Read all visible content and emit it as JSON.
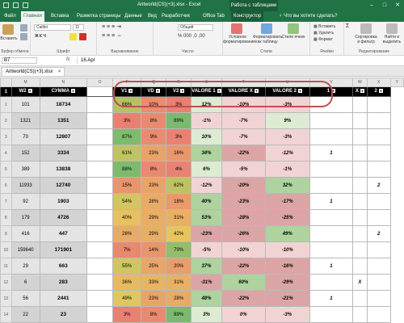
{
  "window": {
    "title": "Aritworld(CS)(+3).xlsx - Excel",
    "context_group": "Работа с таблицами"
  },
  "tabs": [
    "Файл",
    "Главная",
    "Вставка",
    "Разметка страницы",
    "Данные",
    "Вид",
    "Разработчик",
    "Office Tab",
    "Конструктор"
  ],
  "active_tab": "Главная",
  "tell_me": "Что вы хотите сделать?",
  "ribbon": {
    "paste_label": "Вставить",
    "clipboard_label": "Буфер обмена",
    "font_name": "Calibri",
    "font_size": "11",
    "font_label": "Шрифт",
    "align_label": "Выравнивание",
    "number_format": "Общий",
    "number_label": "Число",
    "cond_format": "Условное форматирование",
    "format_table": "Форматировать как таблицу",
    "cell_styles": "Стили ячеек",
    "styles_label": "Стили",
    "insert": "Вставить",
    "delete": "Удалить",
    "format": "Формат",
    "cells_label": "Ячейки",
    "sort_filter": "Сортировка и фильтр",
    "find_select": "Найти и выделить",
    "editing_label": "Редактирование"
  },
  "formula_bar": {
    "name_box": "B7",
    "fx": "fx",
    "value": "16.Apr"
  },
  "workbook_tab": "Aritworld(CS)(+3).xlsx",
  "columns": [
    "M",
    "N",
    "O",
    "P",
    "Q",
    "R",
    "S",
    "T",
    "U",
    "V",
    "W",
    "X",
    "Y"
  ],
  "headers": [
    "W2",
    "СУММА",
    "",
    "V1",
    "VD",
    "V2",
    "VALORE 1",
    "VALORE X",
    "VALORE 2",
    "1",
    "X",
    "2"
  ],
  "rows": [
    {
      "num": "1",
      "w2": "101",
      "sum": "18734",
      "v1": "66%",
      "vd": "10%",
      "v2": "3%",
      "val1": "12%",
      "valx": "-10%",
      "val2": "-3%",
      "c1": "",
      "cx": "",
      "c2": ""
    },
    {
      "num": "2",
      "w2": "1321",
      "sum": "1351",
      "v1": "3%",
      "vd": "8%",
      "v2": "89%",
      "val1": "-1%",
      "valx": "-7%",
      "val2": "9%",
      "c1": "",
      "cx": "",
      "c2": ""
    },
    {
      "num": "3",
      "w2": "70",
      "sum": "12807",
      "v1": "87%",
      "vd": "9%",
      "v2": "3%",
      "val1": "10%",
      "valx": "-7%",
      "val2": "-3%",
      "c1": "",
      "cx": "",
      "c2": ""
    },
    {
      "num": "4",
      "w2": "152",
      "sum": "3334",
      "v1": "61%",
      "vd": "23%",
      "v2": "16%",
      "val1": "34%",
      "valx": "-22%",
      "val2": "-12%",
      "c1": "1",
      "cx": "",
      "c2": ""
    },
    {
      "num": "5",
      "w2": "389",
      "sum": "13838",
      "v1": "88%",
      "vd": "8%",
      "v2": "4%",
      "val1": "6%",
      "valx": "-5%",
      "val2": "-1%",
      "c1": "",
      "cx": "",
      "c2": ""
    },
    {
      "num": "6",
      "w2": "11933",
      "sum": "12740",
      "v1": "15%",
      "vd": "23%",
      "v2": "62%",
      "val1": "-12%",
      "valx": "-20%",
      "val2": "32%",
      "c1": "",
      "cx": "",
      "c2": "2"
    },
    {
      "num": "7",
      "w2": "92",
      "sum": "1903",
      "v1": "54%",
      "vd": "28%",
      "v2": "18%",
      "val1": "40%",
      "valx": "-23%",
      "val2": "-17%",
      "c1": "1",
      "cx": "",
      "c2": ""
    },
    {
      "num": "8",
      "w2": "179",
      "sum": "4726",
      "v1": "40%",
      "vd": "29%",
      "v2": "31%",
      "val1": "53%",
      "valx": "-28%",
      "val2": "-25%",
      "c1": "",
      "cx": "",
      "c2": ""
    },
    {
      "num": "9",
      "w2": "416",
      "sum": "447",
      "v1": "28%",
      "vd": "29%",
      "v2": "42%",
      "val1": "-23%",
      "valx": "-26%",
      "val2": "49%",
      "c1": "",
      "cx": "",
      "c2": "2"
    },
    {
      "num": "10",
      "w2": "159640",
      "sum": "171901",
      "v1": "7%",
      "vd": "14%",
      "v2": "79%",
      "val1": "-5%",
      "valx": "-10%",
      "val2": "-10%",
      "c1": "",
      "cx": "",
      "c2": ""
    },
    {
      "num": "11",
      "w2": "29",
      "sum": "663",
      "v1": "55%",
      "vd": "25%",
      "v2": "20%",
      "val1": "37%",
      "valx": "-22%",
      "val2": "-16%",
      "c1": "1",
      "cx": "",
      "c2": ""
    },
    {
      "num": "12",
      "w2": "6",
      "sum": "283",
      "v1": "36%",
      "vd": "33%",
      "v2": "31%",
      "val1": "-31%",
      "valx": "60%",
      "val2": "-29%",
      "c1": "",
      "cx": "X",
      "c2": ""
    },
    {
      "num": "13",
      "w2": "56",
      "sum": "2441",
      "v1": "49%",
      "vd": "23%",
      "v2": "28%",
      "val1": "48%",
      "valx": "-22%",
      "val2": "-21%",
      "c1": "1",
      "cx": "",
      "c2": ""
    },
    {
      "num": "14",
      "w2": "22",
      "sum": "23",
      "v1": "3%",
      "vd": "8%",
      "v2": "89%",
      "val1": "3%",
      "valx": "0%",
      "val2": "-3%",
      "c1": "",
      "cx": "",
      "c2": ""
    },
    {
      "num": "15",
      "w2": "18922",
      "sum": "20604",
      "v1": "39%",
      "vd": "24%",
      "v2": "37%",
      "val1": "-16%",
      "valx": "18%",
      "val2": "12%",
      "c1": "",
      "cx": "",
      "c2": ""
    }
  ]
}
